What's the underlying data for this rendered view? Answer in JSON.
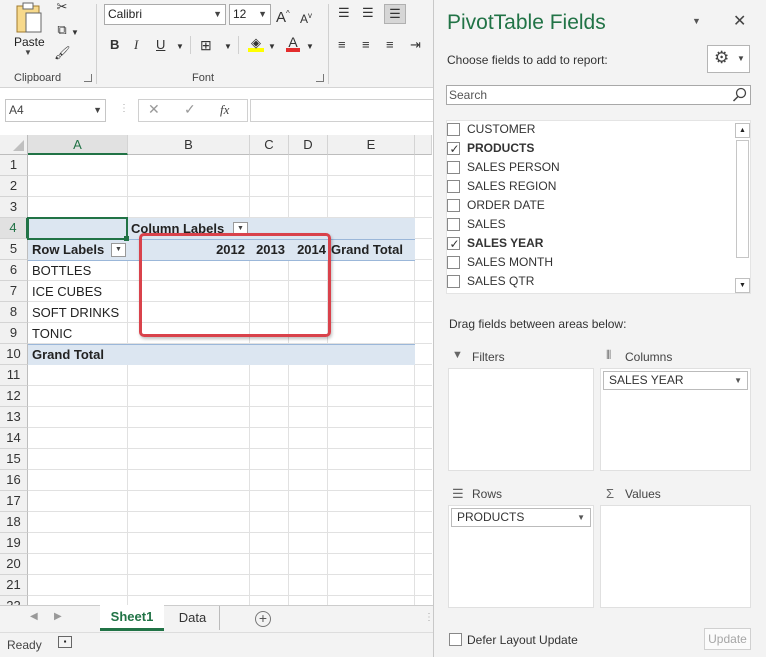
{
  "ribbon": {
    "paste_label": "Paste",
    "clipboard_label": "Clipboard",
    "font_group_label": "Font",
    "font_name": "Calibri",
    "font_size": "12",
    "bold": "B",
    "italic": "I",
    "underline": "U",
    "grow_font": "A",
    "shrink_font": "A"
  },
  "formula_bar": {
    "name_box": "A4",
    "fx": "fx",
    "value": ""
  },
  "grid": {
    "columns": [
      "A",
      "B",
      "C",
      "D",
      "E"
    ],
    "rows": [
      "1",
      "2",
      "3",
      "4",
      "5",
      "6",
      "7",
      "8",
      "9",
      "10",
      "11",
      "12",
      "13",
      "14",
      "15",
      "16",
      "17",
      "18",
      "19",
      "20",
      "21",
      "22"
    ],
    "column_labels": "Column Labels",
    "row_labels": "Row Labels",
    "years": [
      "2012",
      "2013",
      "2014"
    ],
    "grand_total_header": "Grand Total",
    "items": [
      "BOTTLES",
      "ICE CUBES",
      "SOFT DRINKS",
      "TONIC"
    ],
    "grand_total_row": "Grand Total"
  },
  "sheet_tabs": {
    "active": "Sheet1",
    "other": "Data"
  },
  "status": {
    "ready": "Ready"
  },
  "pane": {
    "title": "PivotTable Fields",
    "choose_label": "Choose fields to add to report:",
    "search_placeholder": "Search",
    "fields": [
      {
        "label": "CUSTOMER",
        "checked": false
      },
      {
        "label": "PRODUCTS",
        "checked": true
      },
      {
        "label": "SALES PERSON",
        "checked": false
      },
      {
        "label": "SALES REGION",
        "checked": false
      },
      {
        "label": "ORDER DATE",
        "checked": false
      },
      {
        "label": "SALES",
        "checked": false
      },
      {
        "label": "SALES YEAR",
        "checked": true
      },
      {
        "label": "SALES MONTH",
        "checked": false
      },
      {
        "label": "SALES QTR",
        "checked": false
      }
    ],
    "drag_label": "Drag fields between areas below:",
    "filters_label": "Filters",
    "columns_label": "Columns",
    "rows_label": "Rows",
    "values_label": "Values",
    "columns_field": "SALES YEAR",
    "rows_field": "PRODUCTS",
    "defer_label": "Defer Layout Update",
    "update_label": "Update"
  },
  "colors": {
    "accent_green": "#217346",
    "pivot_header": "#dce6f1",
    "highlight": "#d9424b"
  }
}
